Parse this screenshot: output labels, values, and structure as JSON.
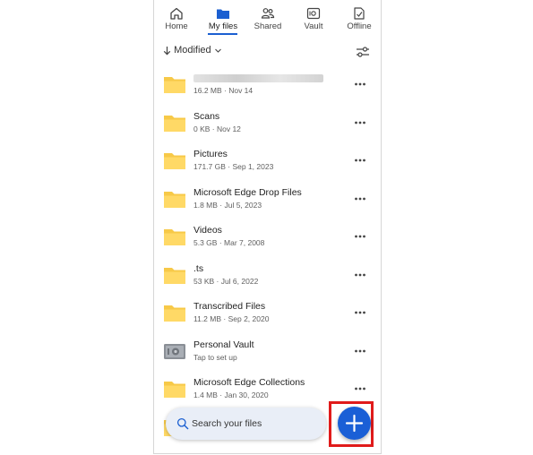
{
  "tabs": [
    {
      "label": "Home",
      "icon": "home-icon",
      "active": false
    },
    {
      "label": "My files",
      "icon": "folder-icon",
      "active": true
    },
    {
      "label": "Shared",
      "icon": "people-icon",
      "active": false
    },
    {
      "label": "Vault",
      "icon": "vault-icon",
      "active": false
    },
    {
      "label": "Offline",
      "icon": "offline-icon",
      "active": false
    }
  ],
  "sort": {
    "label": "Modified"
  },
  "files": [
    {
      "name": "",
      "meta": "16.2 MB · Nov 14",
      "type": "folder"
    },
    {
      "name": "Scans",
      "meta": "0 KB · Nov 12",
      "type": "folder"
    },
    {
      "name": "Pictures",
      "meta": "171.7 GB · Sep 1, 2023",
      "type": "folder"
    },
    {
      "name": "Microsoft Edge Drop Files",
      "meta": "1.8 MB · Jul 5, 2023",
      "type": "folder"
    },
    {
      "name": "Videos",
      "meta": "5.3 GB · Mar 7, 2008",
      "type": "folder"
    },
    {
      "name": ".ts",
      "meta": "53 KB · Jul 6, 2022",
      "type": "folder"
    },
    {
      "name": "Transcribed Files",
      "meta": "11.2 MB · Sep 2, 2020",
      "type": "folder"
    },
    {
      "name": "Personal Vault",
      "meta": "Tap to set up",
      "type": "vault"
    },
    {
      "name": "Microsoft Edge Collections",
      "meta": "1.4 MB · Jan 30, 2020",
      "type": "folder"
    }
  ],
  "search": {
    "placeholder": "Search your files"
  },
  "colors": {
    "accent": "#1b5fd1",
    "folder": "#f7c948",
    "highlight": "#e01b1b"
  }
}
